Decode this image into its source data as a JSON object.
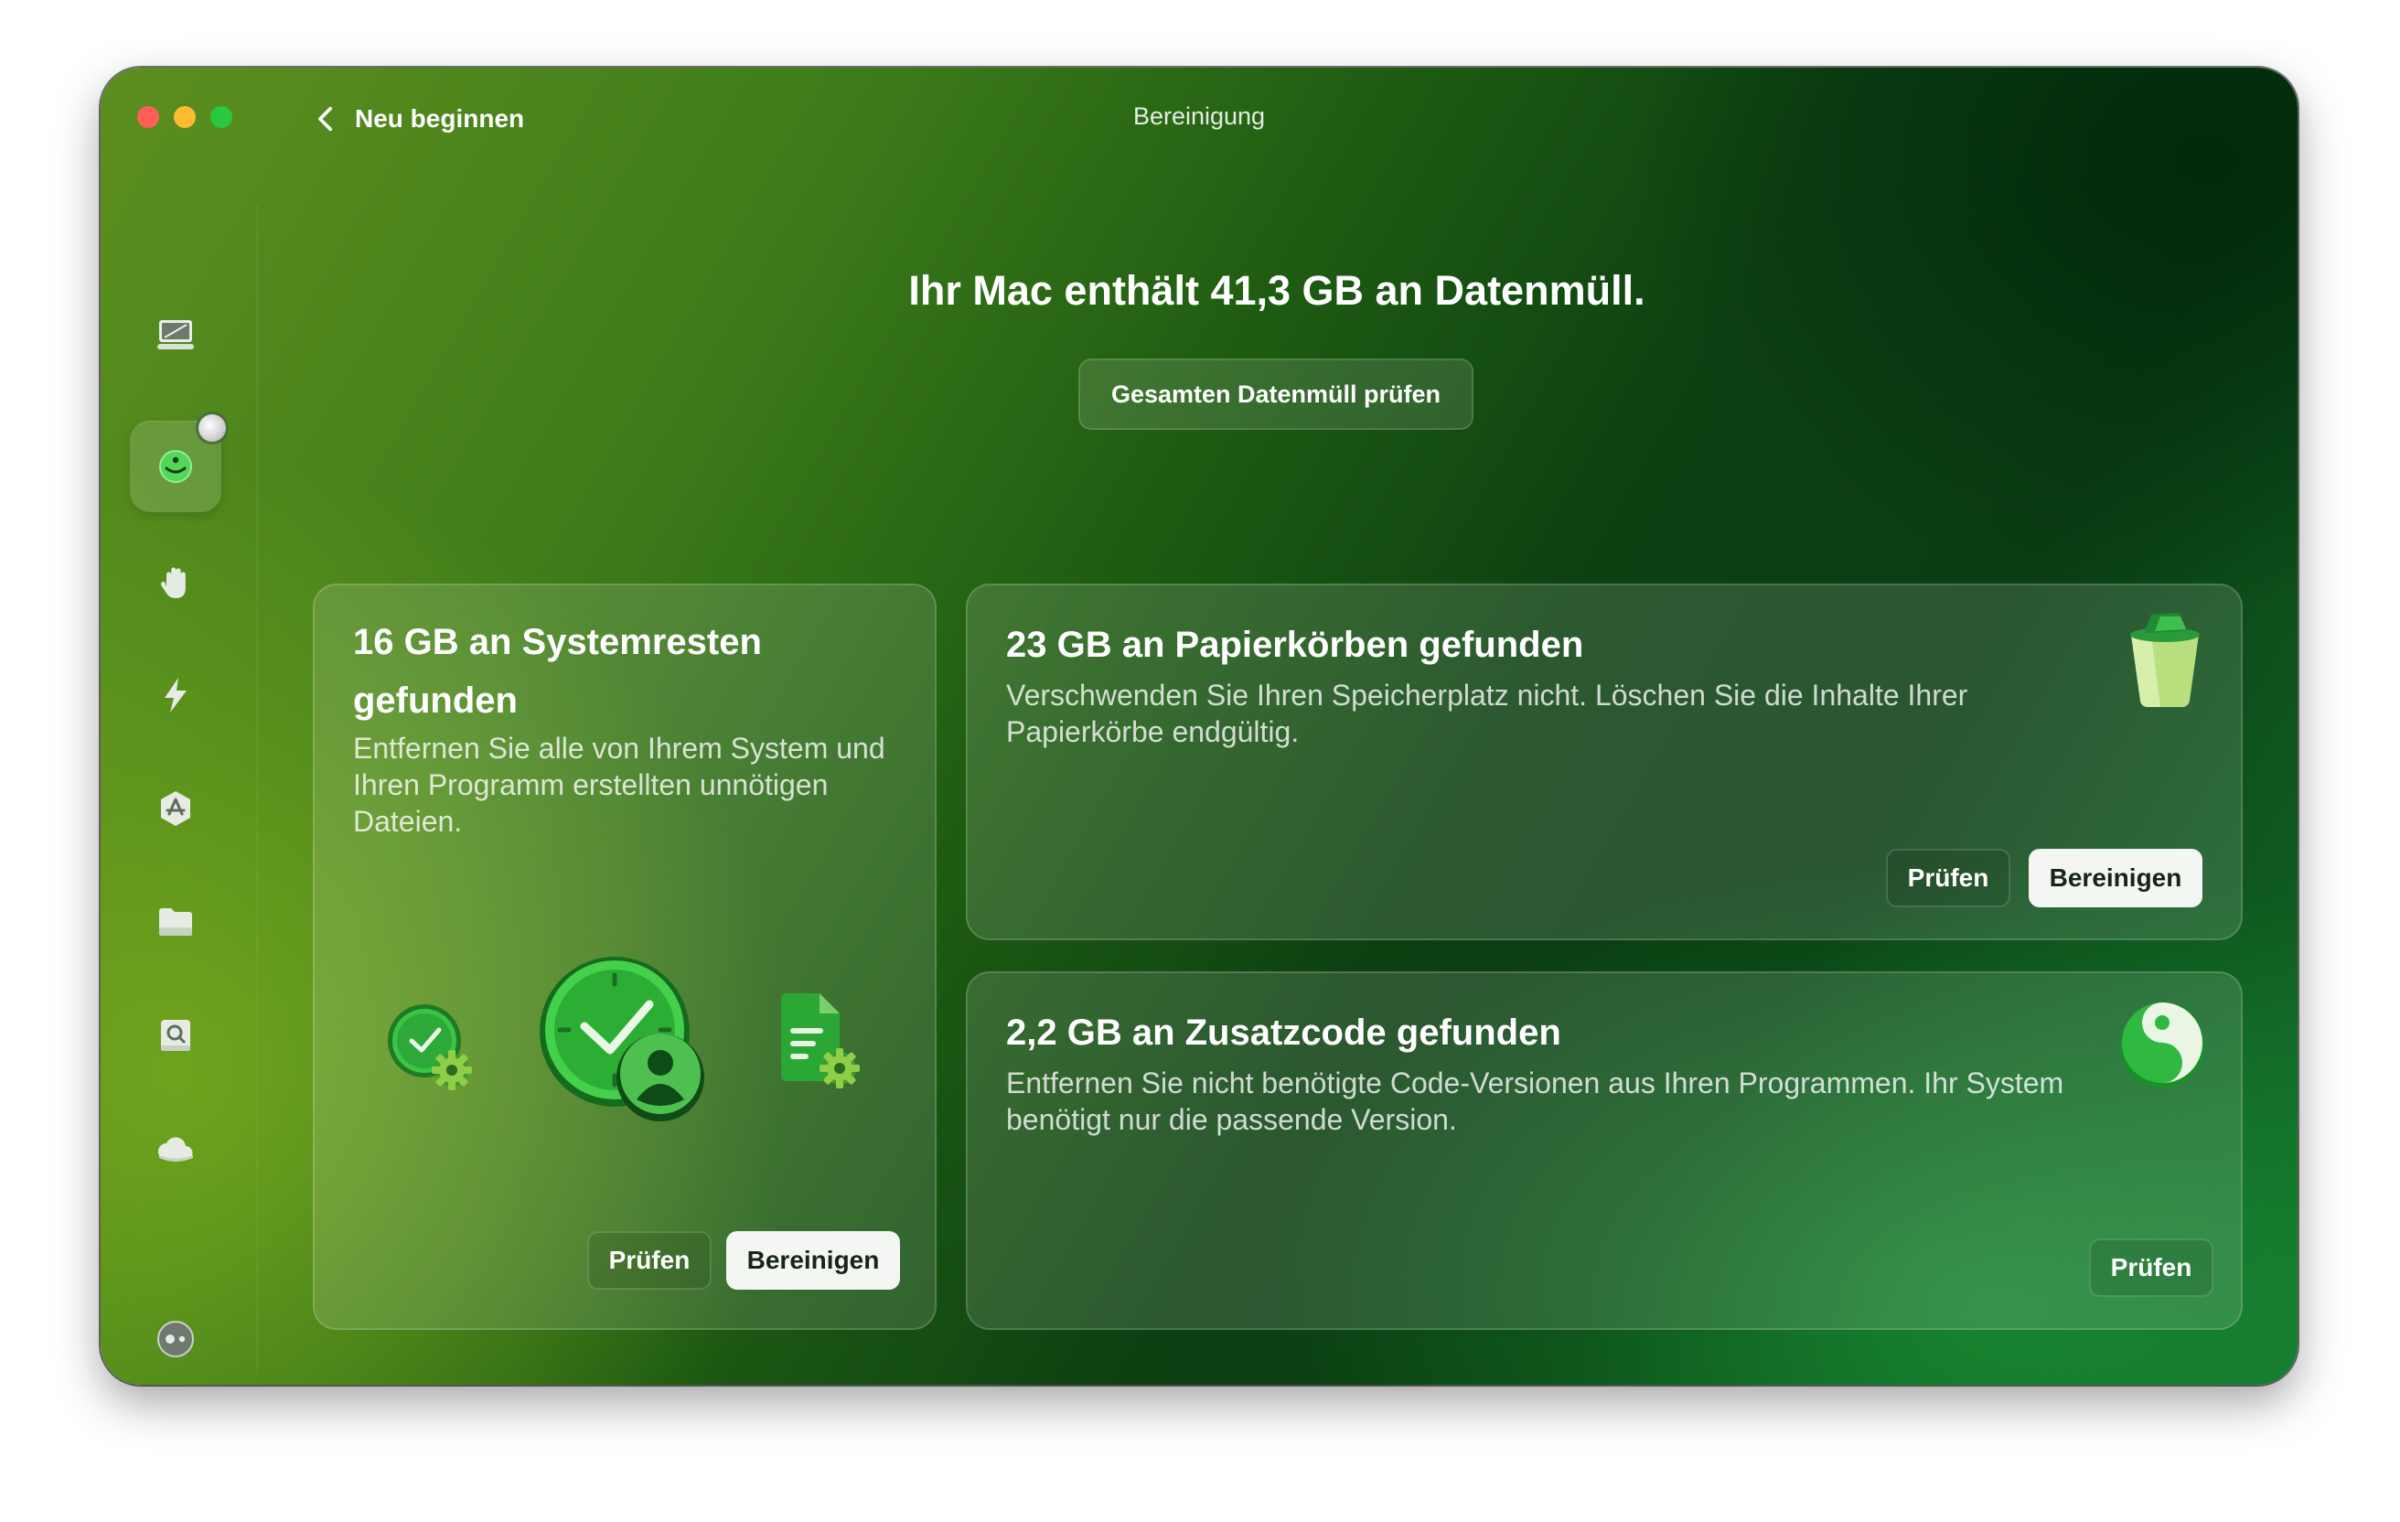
{
  "window": {
    "title": "Bereinigung",
    "back_label": "Neu beginnen"
  },
  "sidebar": {
    "items": [
      {
        "name": "smart-scan",
        "icon": "monitor-icon"
      },
      {
        "name": "cleanup",
        "icon": "cleanup-icon",
        "active": true
      },
      {
        "name": "protection",
        "icon": "hand-icon"
      },
      {
        "name": "performance",
        "icon": "lightning-icon"
      },
      {
        "name": "applications",
        "icon": "app-icon"
      },
      {
        "name": "my-clutter",
        "icon": "folder-icon"
      },
      {
        "name": "space-lens",
        "icon": "lens-icon"
      },
      {
        "name": "cloud",
        "icon": "cloud-icon"
      },
      {
        "name": "assistant",
        "icon": "assistant-icon"
      }
    ]
  },
  "main": {
    "headline": "Ihr Mac enthält 41,3 GB an Datenmüll.",
    "review_all_label": "Gesamten Datenmüll prüfen"
  },
  "cards": {
    "system": {
      "title": "16 GB an Systemresten gefunden",
      "description": "Entfernen Sie alle von Ihrem System und Ihren Programm erstellten unnötigen Dateien.",
      "review_label": "Prüfen",
      "clean_label": "Bereinigen",
      "icons": [
        "clock-gear-icon",
        "clock-user-icon",
        "document-gear-icon"
      ]
    },
    "trash": {
      "title": "23 GB an Papierkörben gefunden",
      "description": "Verschwenden Sie Ihren Speicherplatz nicht. Löschen Sie die Inhalte Ihrer Papierkörbe endgültig.",
      "review_label": "Prüfen",
      "clean_label": "Bereinigen",
      "icon": "trash-bin-icon"
    },
    "binaries": {
      "title": "2,2 GB an Zusatzcode gefunden",
      "description": "Entfernen Sie nicht benötigte Code-Versionen aus Ihren Programmen. Ihr System benötigt nur die passende Version.",
      "review_label": "Prüfen",
      "icon": "code-orb-icon"
    }
  },
  "colors": {
    "accent_green": "#3ecf4a",
    "close": "#ff5f57",
    "minimize": "#febc2e",
    "zoom": "#28c840"
  }
}
